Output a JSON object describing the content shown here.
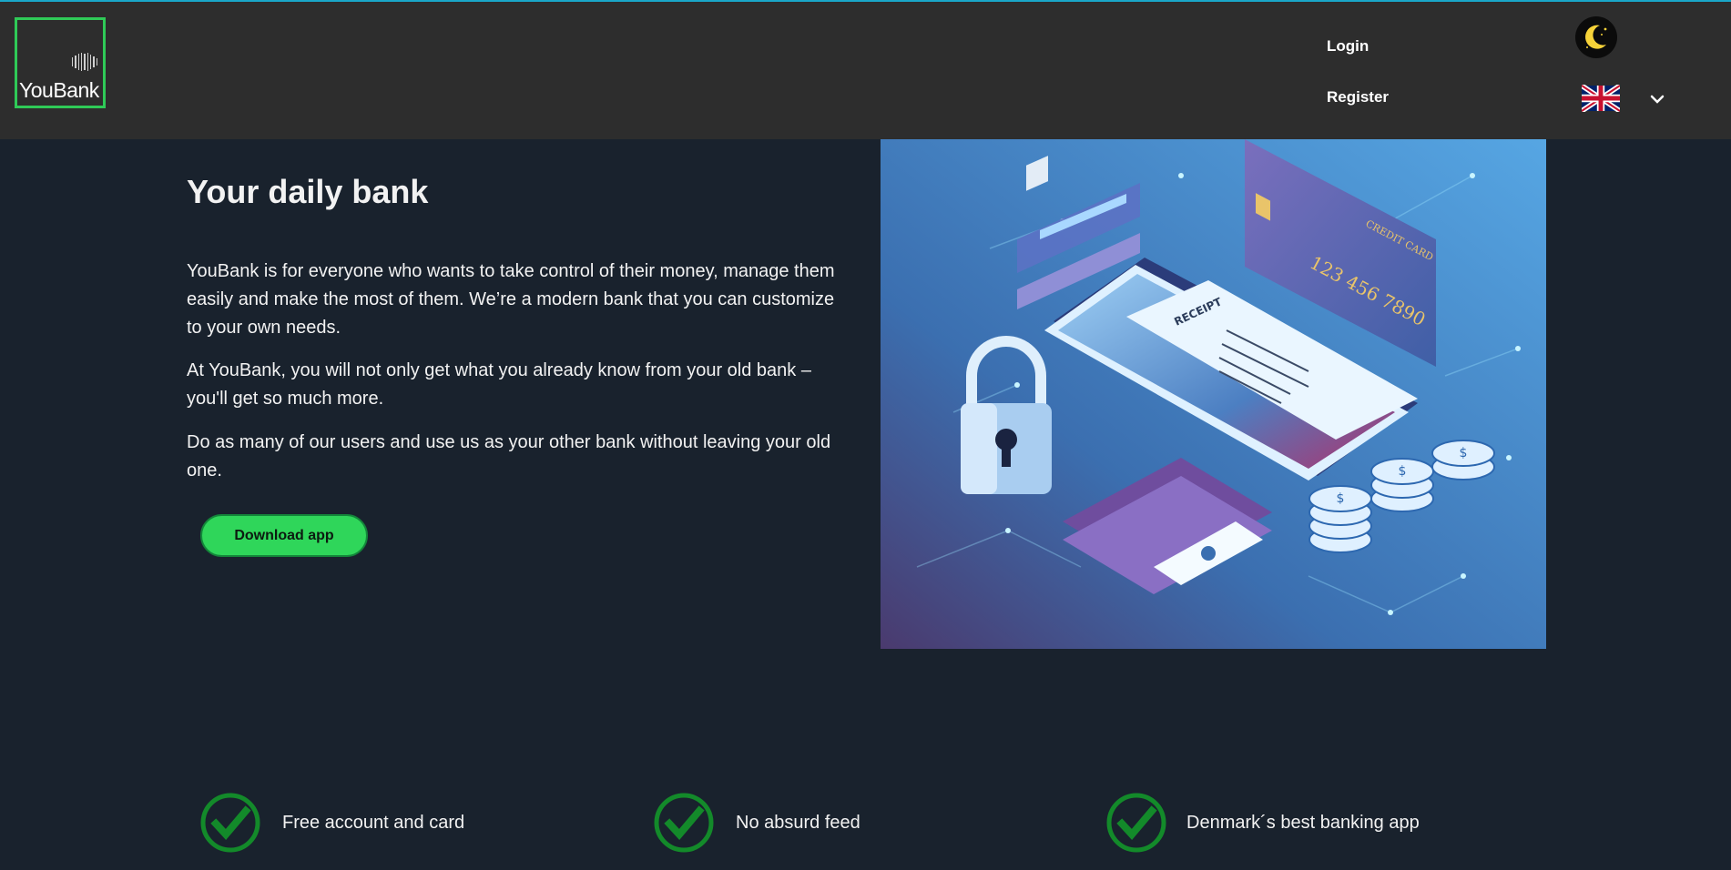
{
  "header": {
    "logo_text": "YouBank",
    "login_label": "Login",
    "register_label": "Register",
    "theme_icon": "moon-icon",
    "language_icon": "uk-flag-icon"
  },
  "hero": {
    "title": "Your daily bank",
    "paragraphs": [
      "YouBank is for everyone who wants to take control of their money, manage them easily and make the most of them. We’re a modern bank that you can customize to your own needs.",
      "At YouBank, you will not only get what you already know from your old bank – you'll get so much more.",
      "Do as many of our users and use us as your other bank without leaving your old one."
    ],
    "download_label": "Download app",
    "illustration_text": {
      "receipt": "RECEIPT",
      "card_label": "CREDIT CARD",
      "card_number": "123 456 7890"
    }
  },
  "features": [
    {
      "label": "Free account and card",
      "icon": "checkmark-icon"
    },
    {
      "label": "No absurd feed",
      "icon": "checkmark-icon"
    },
    {
      "label": "Denmark´s best banking app",
      "icon": "checkmark-icon"
    }
  ],
  "colors": {
    "background": "#19222d",
    "header": "#2d2d2d",
    "accent_green": "#2fd65a",
    "check_green": "#138a2a"
  }
}
